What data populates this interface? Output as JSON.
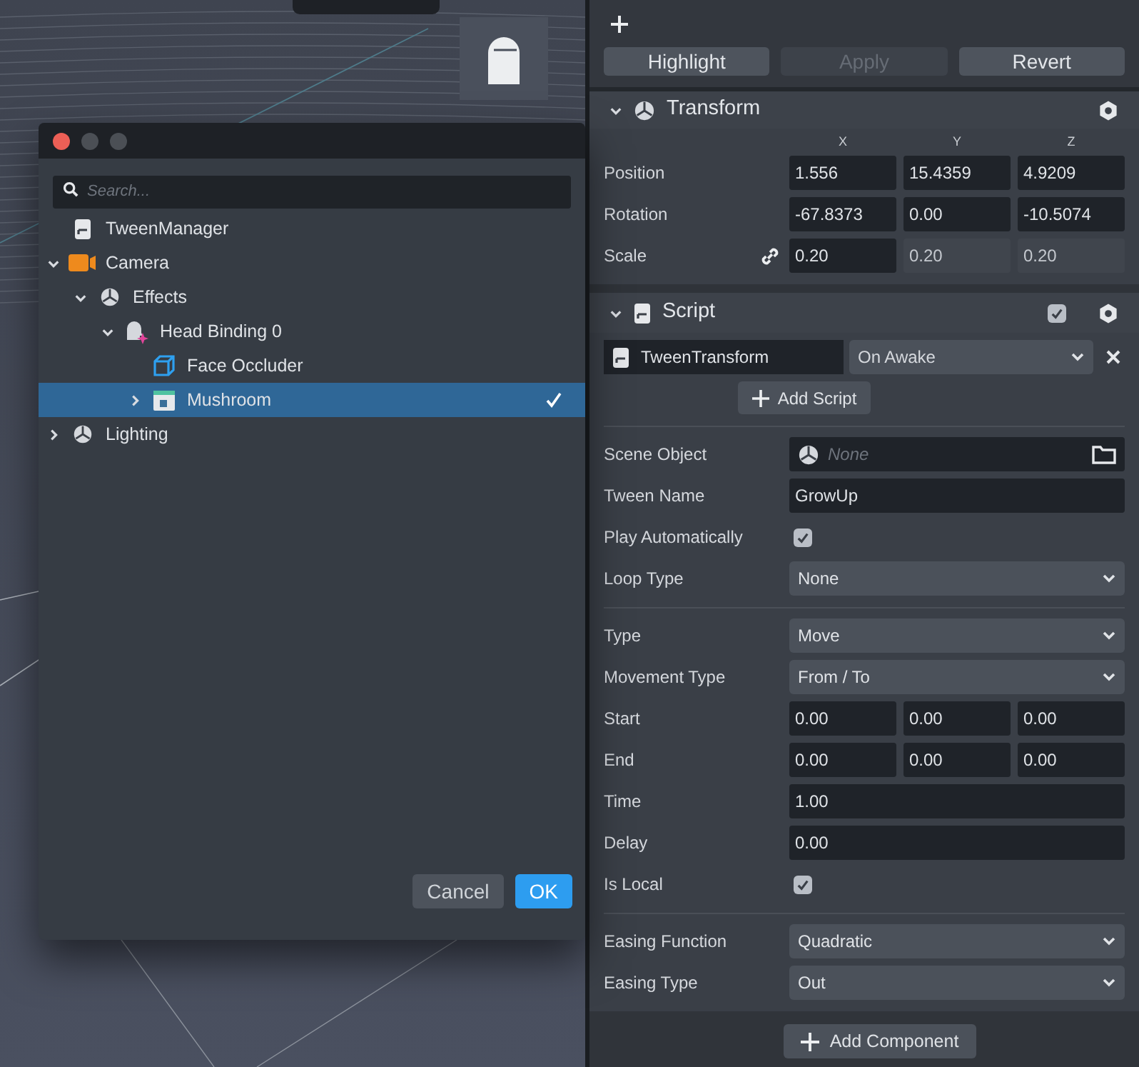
{
  "dialog": {
    "search": {
      "placeholder": "Search..."
    },
    "tree": [
      {
        "label": "TweenManager",
        "kind": "script",
        "expandable": false,
        "selected": false
      },
      {
        "label": "Camera",
        "kind": "camera",
        "expandable": true,
        "expanded": true,
        "selected": false,
        "children": [
          {
            "label": "Effects",
            "kind": "object",
            "expandable": true,
            "expanded": true,
            "selected": false,
            "children": [
              {
                "label": "Head Binding 0",
                "kind": "head",
                "expandable": true,
                "expanded": true,
                "selected": false,
                "children": [
                  {
                    "label": "Face Occluder",
                    "kind": "mesh",
                    "expandable": false,
                    "selected": false
                  },
                  {
                    "label": "Mushroom",
                    "kind": "prefab",
                    "expandable": true,
                    "expanded": false,
                    "selected": true
                  }
                ]
              }
            ]
          }
        ]
      },
      {
        "label": "Lighting",
        "kind": "object",
        "expandable": true,
        "expanded": false,
        "selected": false
      }
    ],
    "buttons": [
      {
        "label": "Cancel",
        "kind": "secondary"
      },
      {
        "label": "OK",
        "kind": "primary"
      }
    ]
  },
  "inspector": {
    "toolbar_buttons": [
      {
        "label": "Highlight",
        "disabled": false
      },
      {
        "label": "Apply",
        "disabled": true
      },
      {
        "label": "Revert",
        "disabled": false
      }
    ],
    "transform": {
      "title": "Transform",
      "axes": [
        "X",
        "Y",
        "Z"
      ],
      "rows": [
        {
          "label": "Position",
          "linked": false,
          "values": [
            "1.556",
            "15.4359",
            "4.9209"
          ]
        },
        {
          "label": "Rotation",
          "linked": false,
          "values": [
            "-67.8373",
            "0.00",
            "-10.5074"
          ]
        },
        {
          "label": "Scale",
          "linked": true,
          "values": [
            "0.20",
            "0.20",
            "0.20"
          ]
        }
      ]
    },
    "script": {
      "title": "Script",
      "enabled": true,
      "script_name": "TweenTransform",
      "trigger": "On Awake",
      "add_script": "Add Script",
      "sections": [
        {
          "fields": [
            {
              "kind": "object",
              "label": "Scene Object",
              "placeholder": "None"
            },
            {
              "kind": "text",
              "label": "Tween Name",
              "value": "GrowUp"
            },
            {
              "kind": "checkbox",
              "label": "Play Automatically",
              "checked": true
            },
            {
              "kind": "select",
              "label": "Loop Type",
              "value": "None"
            }
          ]
        },
        {
          "fields": [
            {
              "kind": "select",
              "label": "Type",
              "value": "Move"
            },
            {
              "kind": "select",
              "label": "Movement Type",
              "value": "From / To"
            },
            {
              "kind": "vector",
              "label": "Start",
              "values": [
                "0.00",
                "0.00",
                "0.00"
              ]
            },
            {
              "kind": "vector",
              "label": "End",
              "values": [
                "0.00",
                "0.00",
                "0.00"
              ]
            },
            {
              "kind": "text",
              "label": "Time",
              "value": "1.00"
            },
            {
              "kind": "text",
              "label": "Delay",
              "value": "0.00"
            },
            {
              "kind": "checkbox",
              "label": "Is Local",
              "checked": true
            }
          ]
        },
        {
          "fields": [
            {
              "kind": "select",
              "label": "Easing Function",
              "value": "Quadratic"
            },
            {
              "kind": "select",
              "label": "Easing Type",
              "value": "Out"
            }
          ]
        }
      ]
    },
    "add_component": "Add Component"
  }
}
